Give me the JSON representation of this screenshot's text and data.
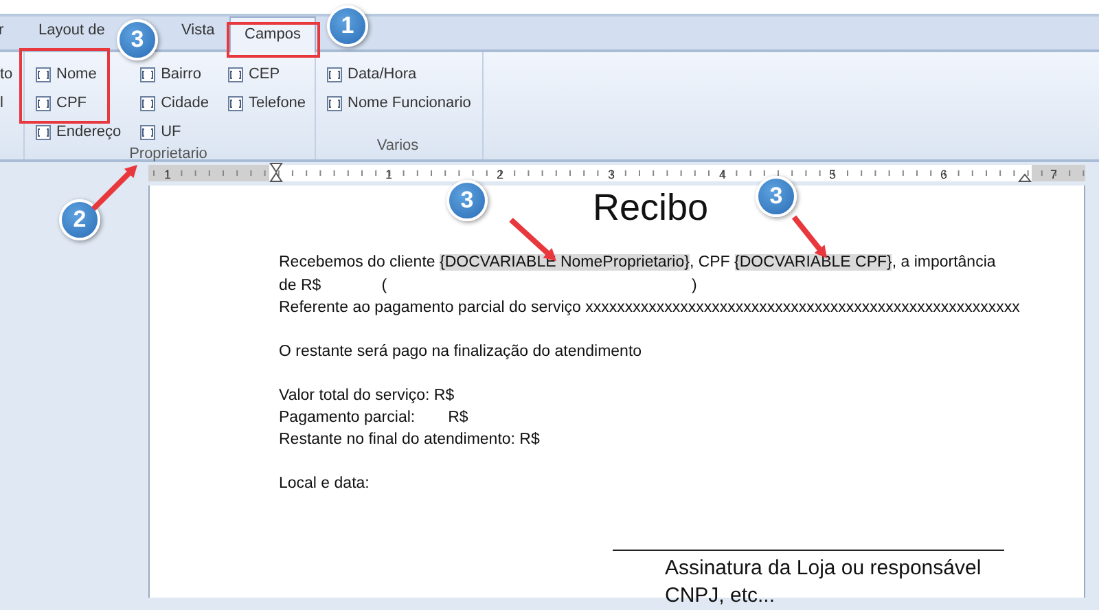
{
  "tabs": [
    {
      "label": "r",
      "selected": false
    },
    {
      "label": "Layout de",
      "selected": false
    },
    {
      "label": "Vista",
      "selected": false
    },
    {
      "label": "Campos",
      "selected": true
    }
  ],
  "ribbon_groups": [
    {
      "columns": [
        [
          {
            "kind": "text",
            "label": "to"
          },
          {
            "kind": "text",
            "label": "l"
          }
        ]
      ]
    },
    {
      "label": "Proprietario",
      "columns": [
        [
          {
            "kind": "field",
            "label": "Nome"
          },
          {
            "kind": "field",
            "label": "CPF"
          },
          {
            "kind": "field",
            "label": "Endereço"
          }
        ],
        [
          {
            "kind": "field",
            "label": "Bairro"
          },
          {
            "kind": "field",
            "label": "Cidade"
          },
          {
            "kind": "field",
            "label": "UF"
          }
        ],
        [
          {
            "kind": "field",
            "label": "CEP"
          },
          {
            "kind": "field",
            "label": "Telefone"
          }
        ]
      ]
    },
    {
      "label": "Varios",
      "columns": [
        [
          {
            "kind": "field",
            "label": "Data/Hora"
          },
          {
            "kind": "field",
            "label": "Nome Funcionario"
          }
        ]
      ]
    }
  ],
  "ruler": {
    "labels": [
      "1",
      "1",
      "2",
      "3",
      "4",
      "5",
      "6",
      "7"
    ]
  },
  "document": {
    "title": "Recibo",
    "lines": [
      {
        "kind": "segments",
        "parts": [
          {
            "text": "Recebemos do cliente ",
            "field": false
          },
          {
            "text": "{DOCVARIABLE NomeProprietario}",
            "field": true
          },
          {
            "text": ", CPF ",
            "field": false
          },
          {
            "text": "{DOCVARIABLE CPF}",
            "field": true
          },
          {
            "text": ", a importância",
            "field": false
          }
        ]
      },
      {
        "kind": "spread",
        "parts": [
          "de R$",
          "(",
          ")"
        ]
      },
      {
        "kind": "text",
        "text": "Referente ao pagamento parcial do serviço xxxxxxxxxxxxxxxxxxxxxxxxxxxxxxxxxxxxxxxxxxxxxxxxxxxxxxx"
      },
      {
        "kind": "blank"
      },
      {
        "kind": "text",
        "text": "O restante será pago na finalização do atendimento"
      },
      {
        "kind": "blank"
      },
      {
        "kind": "text",
        "text": "Valor total do serviço: R$"
      },
      {
        "kind": "pair",
        "parts": [
          "Pagamento parcial:",
          "R$"
        ]
      },
      {
        "kind": "text",
        "text": "Restante no final do atendimento: R$"
      },
      {
        "kind": "blank"
      },
      {
        "kind": "text",
        "text": "Local e data:"
      }
    ],
    "signature": [
      "Assinatura da Loja ou responsável",
      "CNPJ, etc..."
    ]
  },
  "annotations": [
    {
      "kind": "badge",
      "label": "1"
    },
    {
      "kind": "badge",
      "label": "2"
    },
    {
      "kind": "badge",
      "label": "3"
    },
    {
      "kind": "badge",
      "label": "3"
    },
    {
      "kind": "badge",
      "label": "3"
    },
    {
      "kind": "box"
    },
    {
      "kind": "box"
    },
    {
      "kind": "arrow"
    },
    {
      "kind": "arrow"
    },
    {
      "kind": "arrow"
    }
  ]
}
